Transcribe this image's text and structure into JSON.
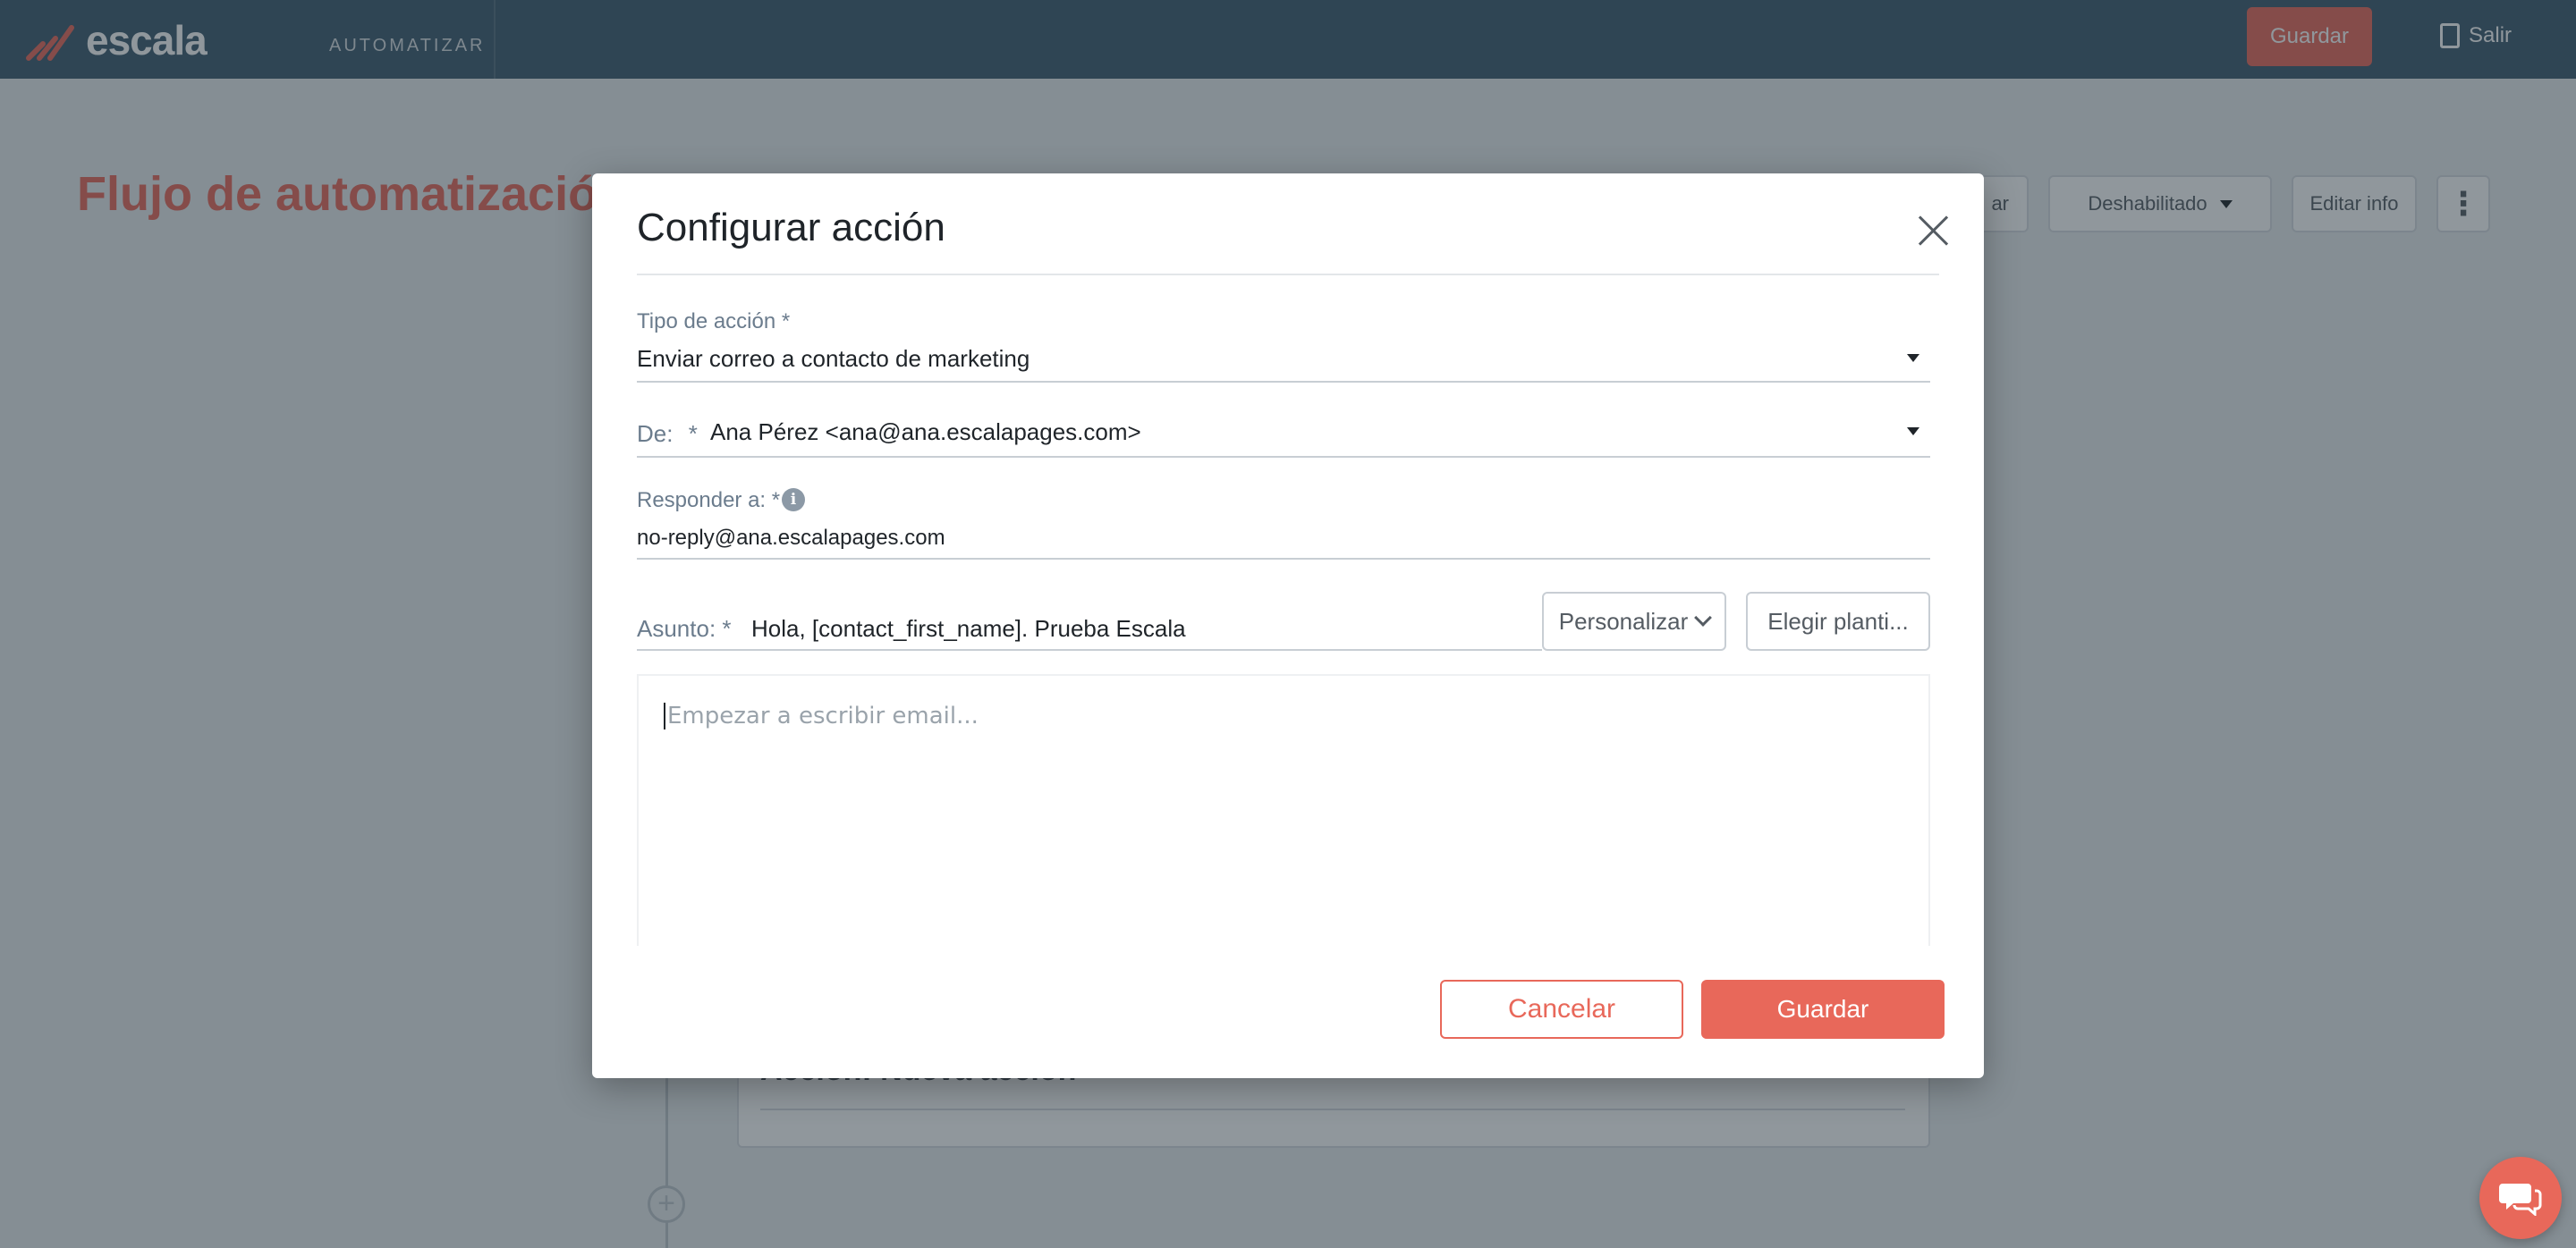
{
  "colors": {
    "brand": "#e8685a",
    "topbar": "#3d5a6e",
    "label": "#6b7c8d"
  },
  "topbar": {
    "logo_text": "escala",
    "section": "AUTOMATIZAR",
    "save_label": "Guardar",
    "logout_label": "Salir"
  },
  "page": {
    "title": "Flujo de automatización",
    "status_label": "Deshabilitado",
    "edit_label": "Editar info",
    "more_label": "⋮",
    "partial_label": "ar"
  },
  "flow": {
    "card_title": "Acción: Nueva acción"
  },
  "modal": {
    "title": "Configurar acción",
    "action_type": {
      "label": "Tipo de acción *",
      "value": "Enviar correo a contacto de marketing"
    },
    "from": {
      "label": "De:",
      "required": "*",
      "value": "Ana Pérez <ana@ana.escalapages.com>"
    },
    "reply_to": {
      "label": "Responder a: *",
      "value": "no-reply@ana.escalapages.com"
    },
    "subject": {
      "label": "Asunto: *",
      "value": "Hola, [contact_first_name]. Prueba Escala"
    },
    "personalize_label": "Personalizar",
    "template_label": "Elegir planti...",
    "editor_placeholder": "Empezar a escribir email...",
    "cancel_label": "Cancelar",
    "save_label": "Guardar"
  }
}
